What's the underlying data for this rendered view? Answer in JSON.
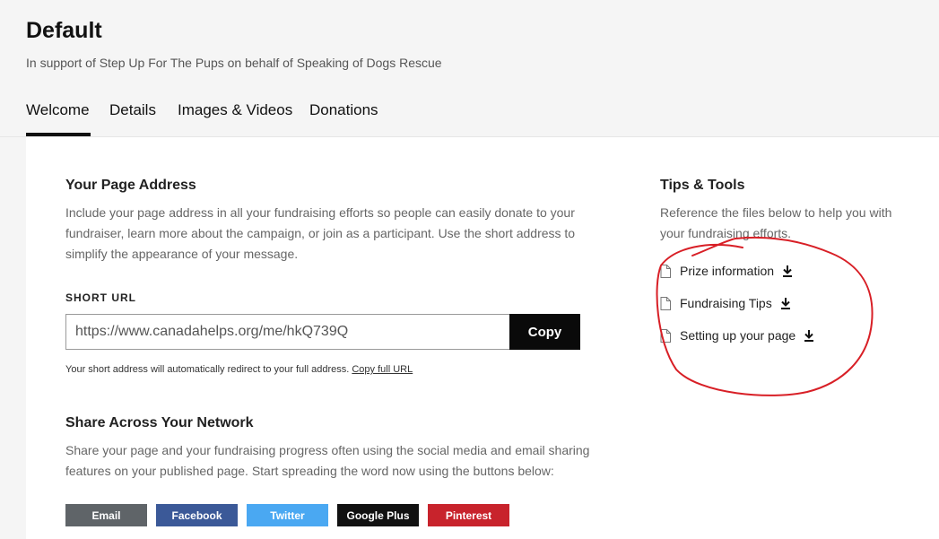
{
  "header": {
    "title": "Default",
    "subtitle": "In support of Step Up For The Pups on behalf of Speaking of Dogs Rescue"
  },
  "tabs": [
    {
      "label": "Welcome",
      "active": true
    },
    {
      "label": "Details",
      "active": false
    },
    {
      "label": "Images & Videos",
      "active": false
    },
    {
      "label": "Donations",
      "active": false
    }
  ],
  "page_address": {
    "heading": "Your Page Address",
    "description": "Include your page address in all your fundraising efforts so people can easily donate to your fundraiser, learn more about the campaign, or join as a participant. Use the short address to simplify the appearance of your message.",
    "short_url_label": "SHORT URL",
    "short_url_value": "https://www.canadahelps.org/me/hkQ739Q",
    "copy_label": "Copy",
    "note_text": "Your short address will automatically redirect to your full address.",
    "copy_full_url_label": "Copy full URL"
  },
  "share": {
    "heading": "Share Across Your Network",
    "description": "Share your page and your fundraising progress often using the social media and email sharing features on your published page. Start spreading the word now using the buttons below:",
    "buttons": [
      {
        "label": "Email",
        "color": "#5f6468"
      },
      {
        "label": "Facebook",
        "color": "#3b5998"
      },
      {
        "label": "Twitter",
        "color": "#4aa8f2"
      },
      {
        "label": "Google Plus",
        "color": "#111111"
      },
      {
        "label": "Pinterest",
        "color": "#c8232c"
      }
    ]
  },
  "tips": {
    "heading": "Tips & Tools",
    "description": "Reference the files below to help you with your fundraising efforts.",
    "files": [
      {
        "label": "Prize information",
        "icon": "file-icon",
        "action_icon": "download-icon"
      },
      {
        "label": "Fundraising Tips",
        "icon": "file-icon",
        "action_icon": "download-icon"
      },
      {
        "label": "Setting up your page",
        "icon": "file-icon",
        "action_icon": "download-icon"
      }
    ]
  },
  "annotation_color": "#d81f26"
}
